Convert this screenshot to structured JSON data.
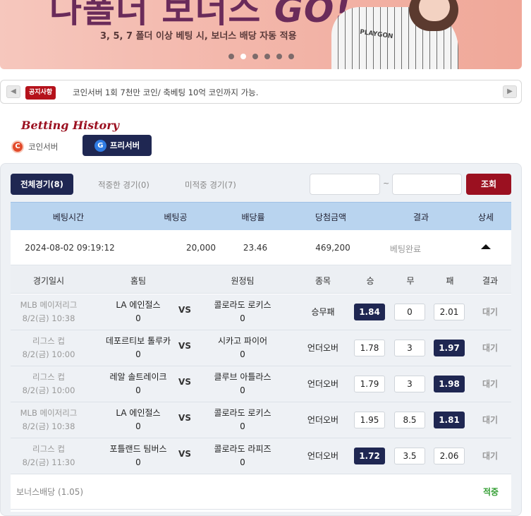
{
  "banner": {
    "title": "나폴더 보너스",
    "title_go": "GO!",
    "subtitle": "3, 5, 7 폴더 이상 베팅 시, 보너스 배당 자동 적용",
    "shirt_logo": "PLAYGON",
    "slide_count": 6,
    "active_slide": 2
  },
  "notice": {
    "badge": "공지사항",
    "text": "코인서버 1회 7천만 코인/ 축베팅 10억 코인까지 가능.",
    "prev": "◀",
    "next": "▶"
  },
  "page": {
    "title": "Betting History"
  },
  "server_tabs": {
    "coin": {
      "icon": "C",
      "label": "코인서버"
    },
    "free": {
      "icon": "G",
      "label": "프리서버"
    }
  },
  "filters": {
    "all": "전체경기(8)",
    "hit": "적중한 경기(0)",
    "miss": "미적중 경기(7)",
    "date_from": "",
    "date_to": "",
    "separator": "~",
    "search": "조회"
  },
  "summary": {
    "headers": [
      "베팅시간",
      "베팅공",
      "배당률",
      "당첨금액",
      "결과",
      "상세"
    ],
    "row": {
      "time": "2024-08-02 09:19:12",
      "amount": "20,000",
      "odds": "23.46",
      "win_amount": "469,200",
      "status": "베팅완료"
    }
  },
  "details": {
    "headers": [
      "경기일시",
      "홈팀",
      "원정팀",
      "종목",
      "승",
      "무",
      "패",
      "결과"
    ],
    "vs": "VS",
    "rows": [
      {
        "league": "MLB 메이저리그",
        "date": "8/2(금) 10:38",
        "home": "LA 에인절스",
        "home_score": "0",
        "away": "콜로라도 로키스",
        "away_score": "0",
        "type": "승무패",
        "win": "1.84",
        "draw": "0",
        "lose": "2.01",
        "selected": "win",
        "result": "대기"
      },
      {
        "league": "리그스 컵",
        "date": "8/2(금) 10:00",
        "home": "데포르티보 톨루카",
        "home_score": "0",
        "away": "시카고 파이어",
        "away_score": "0",
        "type": "언더오버",
        "win": "1.78",
        "draw": "3",
        "lose": "1.97",
        "selected": "lose",
        "result": "대기"
      },
      {
        "league": "리그스 컵",
        "date": "8/2(금) 10:00",
        "home": "레알 솔트레이크",
        "home_score": "0",
        "away": "클루브 아틀라스",
        "away_score": "0",
        "type": "언더오버",
        "win": "1.79",
        "draw": "3",
        "lose": "1.98",
        "selected": "lose",
        "result": "대기"
      },
      {
        "league": "MLB 메이저리그",
        "date": "8/2(금) 10:38",
        "home": "LA 에인절스",
        "home_score": "0",
        "away": "콜로라도 로키스",
        "away_score": "0",
        "type": "언더오버",
        "win": "1.95",
        "draw": "8.5",
        "lose": "1.81",
        "selected": "lose",
        "result": "대기"
      },
      {
        "league": "리그스 컵",
        "date": "8/2(금) 11:30",
        "home": "포틀랜드 팀버스",
        "home_score": "0",
        "away": "콜로라도 라피즈",
        "away_score": "0",
        "type": "언더오버",
        "win": "1.72",
        "draw": "3.5",
        "lose": "2.06",
        "selected": "win",
        "result": "대기"
      }
    ],
    "bonus_label": "보너스배당 (1.05)",
    "bonus_status": "적중"
  },
  "colors": {
    "navy": "#1f2752",
    "crimson": "#9b1020",
    "header_blue": "#b9d4ef",
    "success_green": "#37a037"
  }
}
